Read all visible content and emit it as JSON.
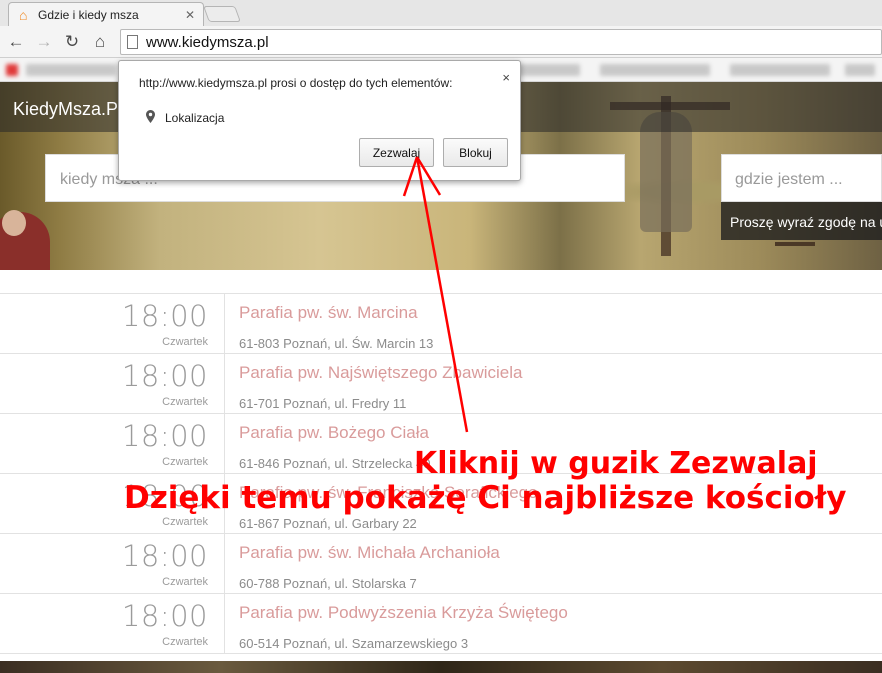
{
  "browser": {
    "tab_title": "Gdzie i kiedy msza",
    "tab_close": "✕",
    "url": "www.kiedymsza.pl",
    "nav": {
      "back": "←",
      "forward": "→",
      "reload": "↻",
      "home": "⌂"
    }
  },
  "site": {
    "brand": "KiedyMsza.Pl",
    "search_when_placeholder": "kiedy msza ...",
    "search_where_placeholder": "gdzie jestem ...",
    "consent_message": "Proszę wyraź zgodę na u"
  },
  "permission_popup": {
    "question": "http://www.kiedymsza.pl prosi o dostęp do tych elementów:",
    "permission_label": "Lokalizacja",
    "allow_label": "Zezwalaj",
    "block_label": "Blokuj",
    "close_label": "×"
  },
  "masses": [
    {
      "time": "18:00",
      "day": "Czwartek",
      "parish": "Parafia pw. św. Marcina",
      "address": "61-803 Poznań, ul. Św. Marcin 13"
    },
    {
      "time": "18:00",
      "day": "Czwartek",
      "parish": "Parafia pw. Najświętszego Zbawiciela",
      "address": "61-701 Poznań, ul. Fredry 11"
    },
    {
      "time": "18:00",
      "day": "Czwartek",
      "parish": "Parafia pw. Bożego Ciała",
      "address": "61-846 Poznań, ul. Strzelecka 40"
    },
    {
      "time": "18:00",
      "day": "Czwartek",
      "parish": "Parafia pw. św. Franciszka Serafickiego",
      "address": "61-867 Poznań, ul. Garbary 22"
    },
    {
      "time": "18:00",
      "day": "Czwartek",
      "parish": "Parafia pw. św. Michała Archanioła",
      "address": "60-788 Poznań, ul. Stolarska 7"
    },
    {
      "time": "18:00",
      "day": "Czwartek",
      "parish": "Parafia pw. Podwyższenia Krzyża Świętego",
      "address": "60-514 Poznań, ul. Szamarzewskiego 3"
    }
  ],
  "annotation": {
    "line1": "Kliknij w guzik Zezwalaj",
    "line2": "Dzięki temu pokażę Ci najbliższe kościoły",
    "color": "#ff0000"
  },
  "colors": {
    "parish_link": "#d99b9b",
    "time_text": "#9b9b9b"
  }
}
